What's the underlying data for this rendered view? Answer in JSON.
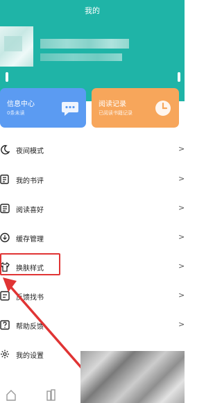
{
  "header": {
    "title": "我的",
    "background_color": "#1fb4a7"
  },
  "profile": {
    "avatar_icon": "avatar-blurred",
    "name_hidden": true
  },
  "cards": [
    {
      "title": "信息中心",
      "subtitle": "0条未读",
      "icon": "chat-bubble-icon",
      "color": "#5b9bf2"
    },
    {
      "title": "阅读记录",
      "subtitle": "已阅读书籍记录",
      "icon": "clock-icon",
      "color": "#f7a65b"
    }
  ],
  "menu": [
    {
      "label": "夜间模式",
      "icon": "moon-icon"
    },
    {
      "label": "我的书评",
      "icon": "book-review-icon"
    },
    {
      "label": "阅读喜好",
      "icon": "reading-preference-icon"
    },
    {
      "label": "缓存管理",
      "icon": "download-icon"
    },
    {
      "label": "换肤样式",
      "icon": "tshirt-icon"
    },
    {
      "label": "反馈找书",
      "icon": "feedback-book-icon"
    },
    {
      "label": "帮助反馈",
      "icon": "help-icon"
    },
    {
      "label": "我的设置",
      "icon": "gear-icon"
    }
  ],
  "annotation": {
    "highlight_color": "#e03434",
    "highlighted_item": "换肤样式"
  },
  "bottom_tabs": [
    {
      "icon": "home-icon"
    },
    {
      "icon": "bookshelf-icon"
    }
  ]
}
